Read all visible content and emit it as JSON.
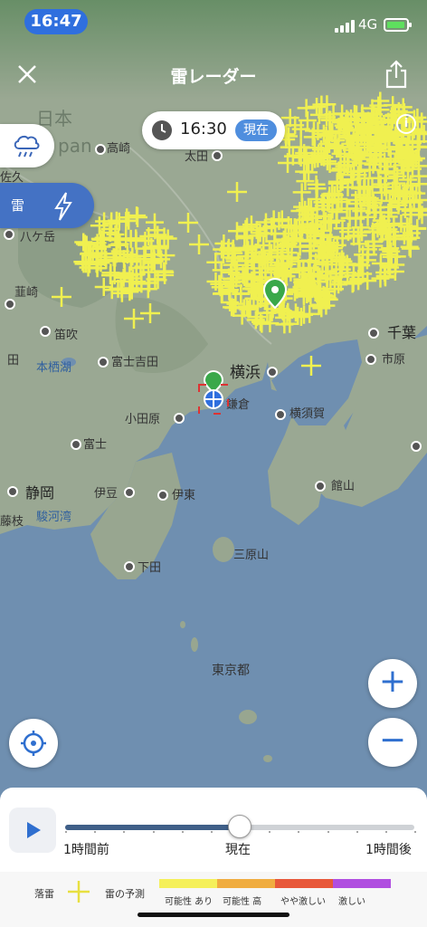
{
  "status_bar": {
    "time": "16:47",
    "network": "4G"
  },
  "header": {
    "title": "雷レーダー"
  },
  "time_bubble": {
    "time": "16:30",
    "badge": "現在"
  },
  "layers": {
    "rain_icon": "rain-cloud-icon",
    "thunder_label": "雷",
    "thunder_icon": "lightning-icon"
  },
  "map": {
    "labels": {
      "takasaki": "高崎",
      "ota": "太田",
      "yatsugatake": "八ケ岳",
      "nirasaki": "韮崎",
      "fuefuki": "笛吹",
      "fujiyoshida": "富士吉田",
      "motosuko": "本栖湖",
      "yokohama": "横浜",
      "kamakura": "鎌倉",
      "odawara": "小田原",
      "yokosuka": "横須賀",
      "chiba": "千葉",
      "ichihara": "市原",
      "fuji": "富士",
      "shizuoka": "静岡",
      "izu": "伊豆",
      "ito": "伊東",
      "tateyama": "館山",
      "surugawan": "駿河湾",
      "fujieda": "藤枝",
      "shimoda": "下田",
      "miharayama": "三原山",
      "tokyoto": "東京都",
      "nihon": "日本",
      "japan_partial": "pan",
      "saku_partial": "佐久",
      "kai_partial": "田"
    }
  },
  "controls": {
    "zoom_in": "+",
    "zoom_out": "−"
  },
  "timeline": {
    "start_label": "1時間前",
    "now_label": "現在",
    "end_label": "1時間後",
    "progress": 0.5
  },
  "legend": {
    "strike_label": "落雷",
    "forecast_label": "雷の予測",
    "levels": [
      {
        "label": "可能性 あり",
        "color": "#f5f05a"
      },
      {
        "label": "可能性 高",
        "color": "#f0ad40"
      },
      {
        "label": "やや激しい",
        "color": "#e8583a"
      },
      {
        "label": "激しい",
        "color": "#b04ee0"
      }
    ]
  },
  "colors": {
    "accent": "#2f6fcf",
    "strike": "#f0f050",
    "sea": "#6f8fb0",
    "land": "#9fae98"
  }
}
